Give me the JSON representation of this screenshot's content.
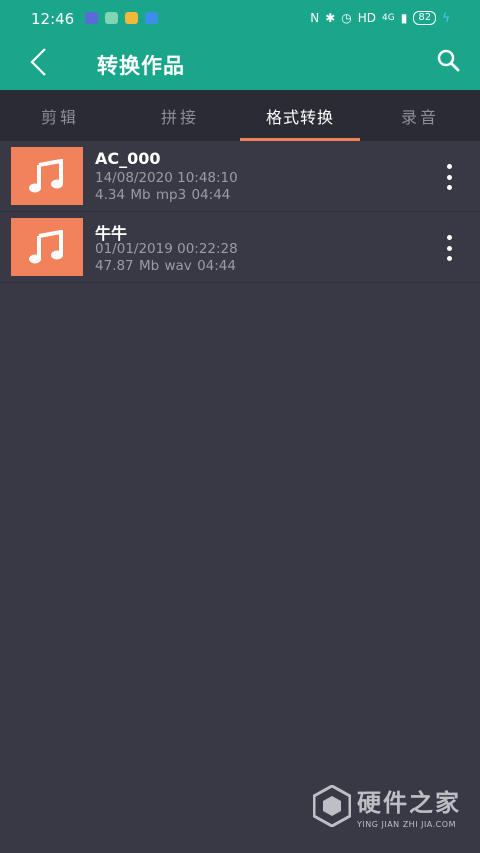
{
  "status_bar": {
    "time": "12:46",
    "right_text": "HD",
    "network": "4G",
    "battery": "82"
  },
  "app_bar": {
    "title": "转换作品"
  },
  "tabs": [
    {
      "label": "剪辑",
      "active": false
    },
    {
      "label": "拼接",
      "active": false
    },
    {
      "label": "格式转换",
      "active": true
    },
    {
      "label": "录音",
      "active": false
    }
  ],
  "files": [
    {
      "name": "AC_000",
      "date": "14/08/2020 10:48:10",
      "size": "4.34 Mb",
      "format": "mp3",
      "duration": "04:44"
    },
    {
      "name": "牛牛",
      "date": "01/01/2019 00:22:28",
      "size": "47.87 Mb",
      "format": "wav",
      "duration": "04:44"
    }
  ],
  "watermark": {
    "main": "硬件之家",
    "sub": "YING JIAN ZHI JIA.COM"
  },
  "colors": {
    "primary": "#1aa68a",
    "accent": "#f0825a",
    "background": "#383944",
    "tab_bar": "#2b2c33"
  }
}
